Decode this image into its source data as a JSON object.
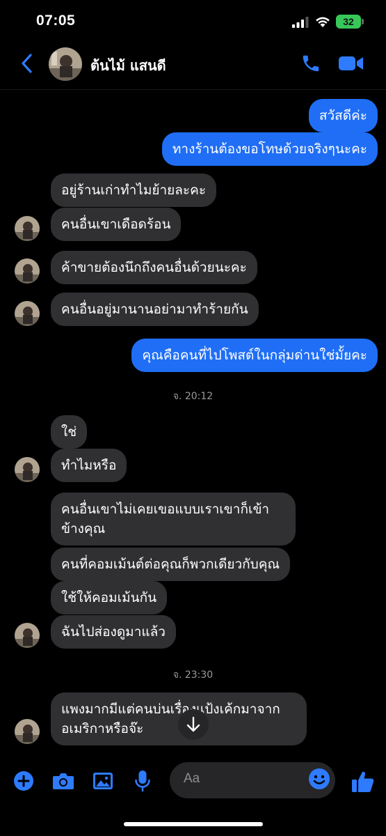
{
  "status_bar": {
    "time": "07:05",
    "battery": "32"
  },
  "header": {
    "contact_name": "ต้นไม้ แสนดี"
  },
  "messages": [
    {
      "dir": "out",
      "text": "สวัสดีค่ะ"
    },
    {
      "dir": "out",
      "text": "ทางร้านต้องขอโทษด้วยจริงๆนะคะ"
    },
    {
      "dir": "in",
      "text": "อยู่ร้านเก่าทำไมย้ายละคะ"
    },
    {
      "dir": "in",
      "text": "คนอื่นเขาเดือดร้อน"
    },
    {
      "dir": "in",
      "text": "ค้าขายต้องนึกถึงคนอื่นด้วยนะคะ"
    },
    {
      "dir": "in",
      "text": "คนอื่นอยู่มานานอย่ามาทำร้ายกัน"
    },
    {
      "dir": "out",
      "text": "คุณคือคนที่ไปโพสต์ในกลุ่มด่านใช่มั้ยคะ"
    },
    {
      "dir": "in",
      "text": "ใช่"
    },
    {
      "dir": "in",
      "text": "ทำไมหรือ"
    },
    {
      "dir": "in",
      "text": "คนอื่นเขาไม่เคยเขอแบบเราเขาก็เข้าข้างคุณ"
    },
    {
      "dir": "in",
      "text": "คนที่คอมเม้นต์ต่อคุณก็พวกเดียวกับคุณ"
    },
    {
      "dir": "in",
      "text": "ใช้ให้คอมเม้นกัน"
    },
    {
      "dir": "in",
      "text": "ฉันไปส่องดูมาแล้ว"
    },
    {
      "dir": "in",
      "text": "แพงมากมีแต่คนบ่นเรื่องแป้งเค้กมาจากอเมริกาหรือจ๊ะ"
    }
  ],
  "timestamps": [
    "จ. 20:12",
    "จ. 23:30"
  ],
  "composer": {
    "placeholder": "Aa"
  },
  "icons": {
    "back": "chevron-left-icon",
    "call": "phone-icon",
    "video": "video-camera-icon",
    "add": "plus-circle-icon",
    "camera": "camera-icon",
    "gallery": "image-icon",
    "mic": "microphone-icon",
    "emoji": "smiley-icon",
    "like": "thumbs-up-icon",
    "scroll": "arrow-down-icon"
  },
  "colors": {
    "accent": "#1f6ef5",
    "outgoing_bubble": "#1f6ef5",
    "incoming_bubble": "#303033",
    "background": "#000000",
    "battery": "#38c85a"
  }
}
